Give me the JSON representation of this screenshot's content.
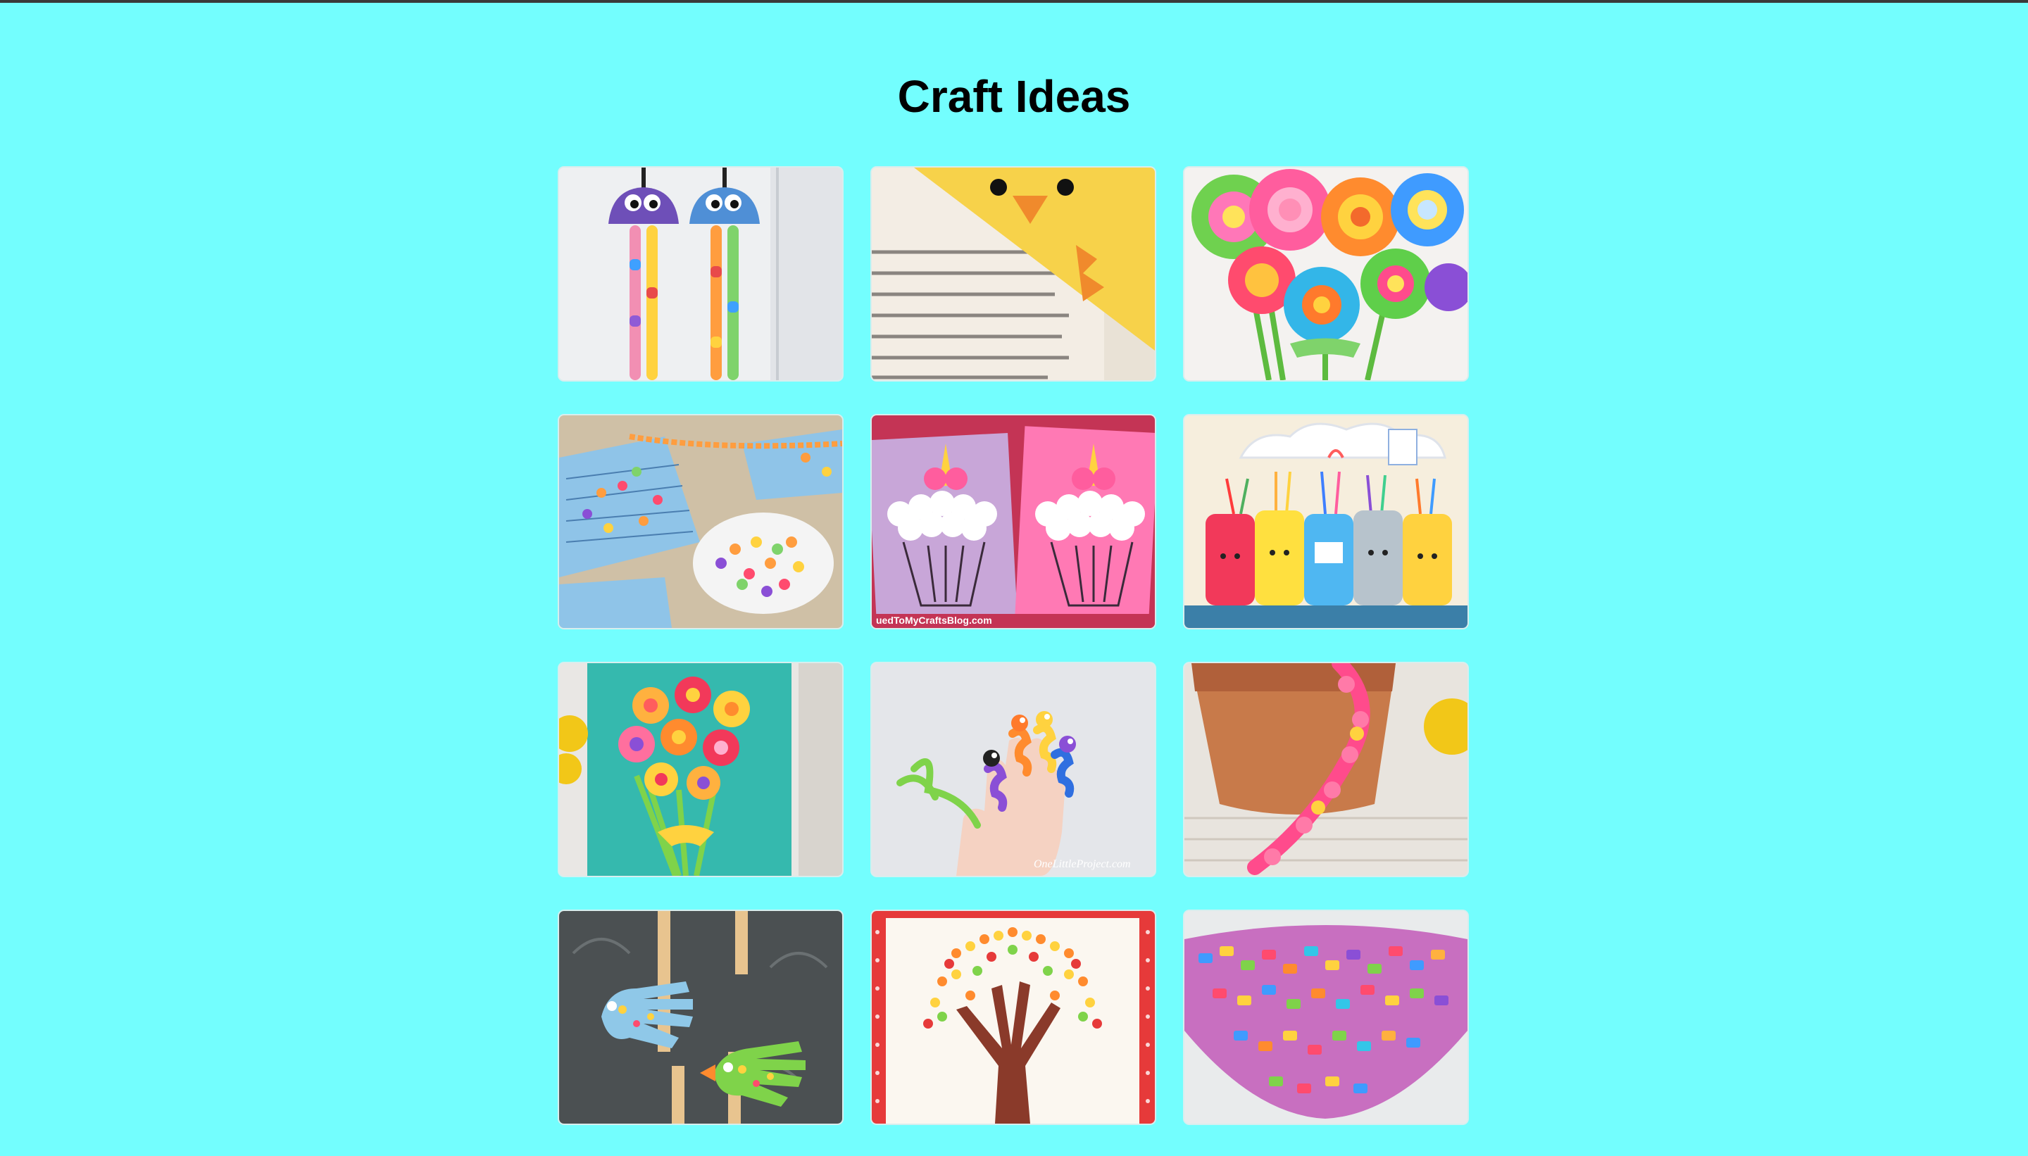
{
  "page": {
    "title": "Craft Ideas"
  },
  "colors": {
    "background": "#73fefe",
    "title": "#000000"
  },
  "gallery": {
    "items": [
      {
        "name": "egg-carton-bead-jellyfish-image",
        "visible_text": ""
      },
      {
        "name": "chick-corner-bookmark-image",
        "visible_text": ""
      },
      {
        "name": "felt-button-flower-bouquet-image",
        "visible_text": ""
      },
      {
        "name": "cereal-necklace-counting-image",
        "visible_text": ""
      },
      {
        "name": "unicorn-cupcake-cotton-ball-image",
        "visible_text": "uedToMyCraftsBlog.com"
      },
      {
        "name": "kawaii-mason-jar-pencil-holders-image",
        "visible_text": ""
      },
      {
        "name": "egg-carton-flower-bouquet-image",
        "visible_text": ""
      },
      {
        "name": "pipe-cleaner-finger-puppets-image",
        "visible_text": "OneLittleProject.com"
      },
      {
        "name": "paper-flower-garland-flowerpot-image",
        "visible_text": ""
      },
      {
        "name": "handprint-fish-puppets-image",
        "visible_text": ""
      },
      {
        "name": "handprint-dot-tree-painting-image",
        "visible_text": ""
      },
      {
        "name": "melted-bead-bowl-image",
        "visible_text": ""
      }
    ]
  }
}
